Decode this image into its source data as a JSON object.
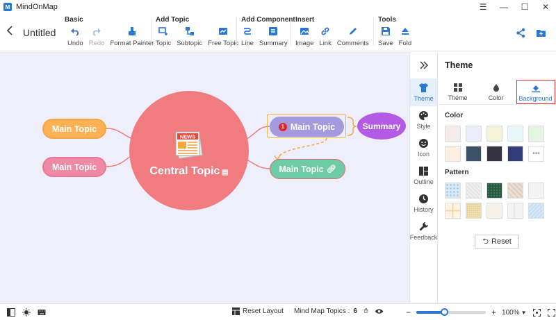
{
  "app": {
    "title": "MindOnMap",
    "doc_title": "Untitled"
  },
  "toolbar": {
    "groups": [
      {
        "title": "Basic",
        "items": [
          {
            "label": "Undo",
            "icon": "undo-icon"
          },
          {
            "label": "Redo",
            "icon": "redo-icon",
            "disabled": true
          },
          {
            "label": "Format Painter",
            "icon": "format-painter-icon"
          }
        ]
      },
      {
        "title": "Add Topic",
        "items": [
          {
            "label": "Topic",
            "icon": "topic-icon"
          },
          {
            "label": "Subtopic",
            "icon": "subtopic-icon"
          },
          {
            "label": "Free Topic",
            "icon": "free-topic-icon"
          }
        ]
      },
      {
        "title": "Add Component",
        "items": [
          {
            "label": "Line",
            "icon": "line-icon"
          },
          {
            "label": "Summary",
            "icon": "summary-icon"
          }
        ]
      },
      {
        "title": "Insert",
        "items": [
          {
            "label": "Image",
            "icon": "image-icon"
          },
          {
            "label": "Link",
            "icon": "link-icon"
          },
          {
            "label": "Comments",
            "icon": "comments-icon"
          }
        ]
      },
      {
        "title": "Tools",
        "items": [
          {
            "label": "Save",
            "icon": "save-icon"
          },
          {
            "label": "Fold",
            "icon": "fold-icon"
          }
        ]
      }
    ]
  },
  "mindmap": {
    "central": "Central Topic",
    "left_topics": [
      "Main Topic",
      "Main Topic"
    ],
    "right_topic_1": "Main Topic",
    "right_topic_1_badge": "1",
    "right_topic_2": "Main Topic",
    "summary": "Summary",
    "central_icon_text": "NEWS"
  },
  "rail": {
    "items": [
      {
        "label": "Theme",
        "icon": "shirt-icon"
      },
      {
        "label": "Style",
        "icon": "palette-icon"
      },
      {
        "label": "Icon",
        "icon": "smiley-icon"
      },
      {
        "label": "Outline",
        "icon": "outline-icon"
      },
      {
        "label": "History",
        "icon": "clock-icon"
      },
      {
        "label": "Feedback",
        "icon": "wrench-icon"
      }
    ]
  },
  "panel": {
    "title": "Theme",
    "tabs": [
      "Theme",
      "Color",
      "Background"
    ],
    "color_label": "Color",
    "pattern_label": "Pattern",
    "reset_label": "Reset",
    "colors": [
      "#f6ecec",
      "#ececfb",
      "#f3f3d8",
      "#e8f8fa",
      "#e5f6e2",
      "#fdeee2",
      "#3b5069",
      "#34333f",
      "#333a78"
    ],
    "patterns": [
      "#d7eaf7",
      "#eeeeee",
      "#23583d",
      "#eadcd1",
      "#f4f4f4",
      "#fff4e3",
      "#f6eac9",
      "#f3f3ea",
      "#f4f4f4",
      "#d6e8f7"
    ]
  },
  "status": {
    "reset_layout": "Reset Layout",
    "topics_label": "Mind Map Topics :",
    "topics_count": "6",
    "zoom": "100%",
    "zoom_level": 0.4
  },
  "colors": {
    "accent": "#2a78d6",
    "central": "#f07c80"
  }
}
